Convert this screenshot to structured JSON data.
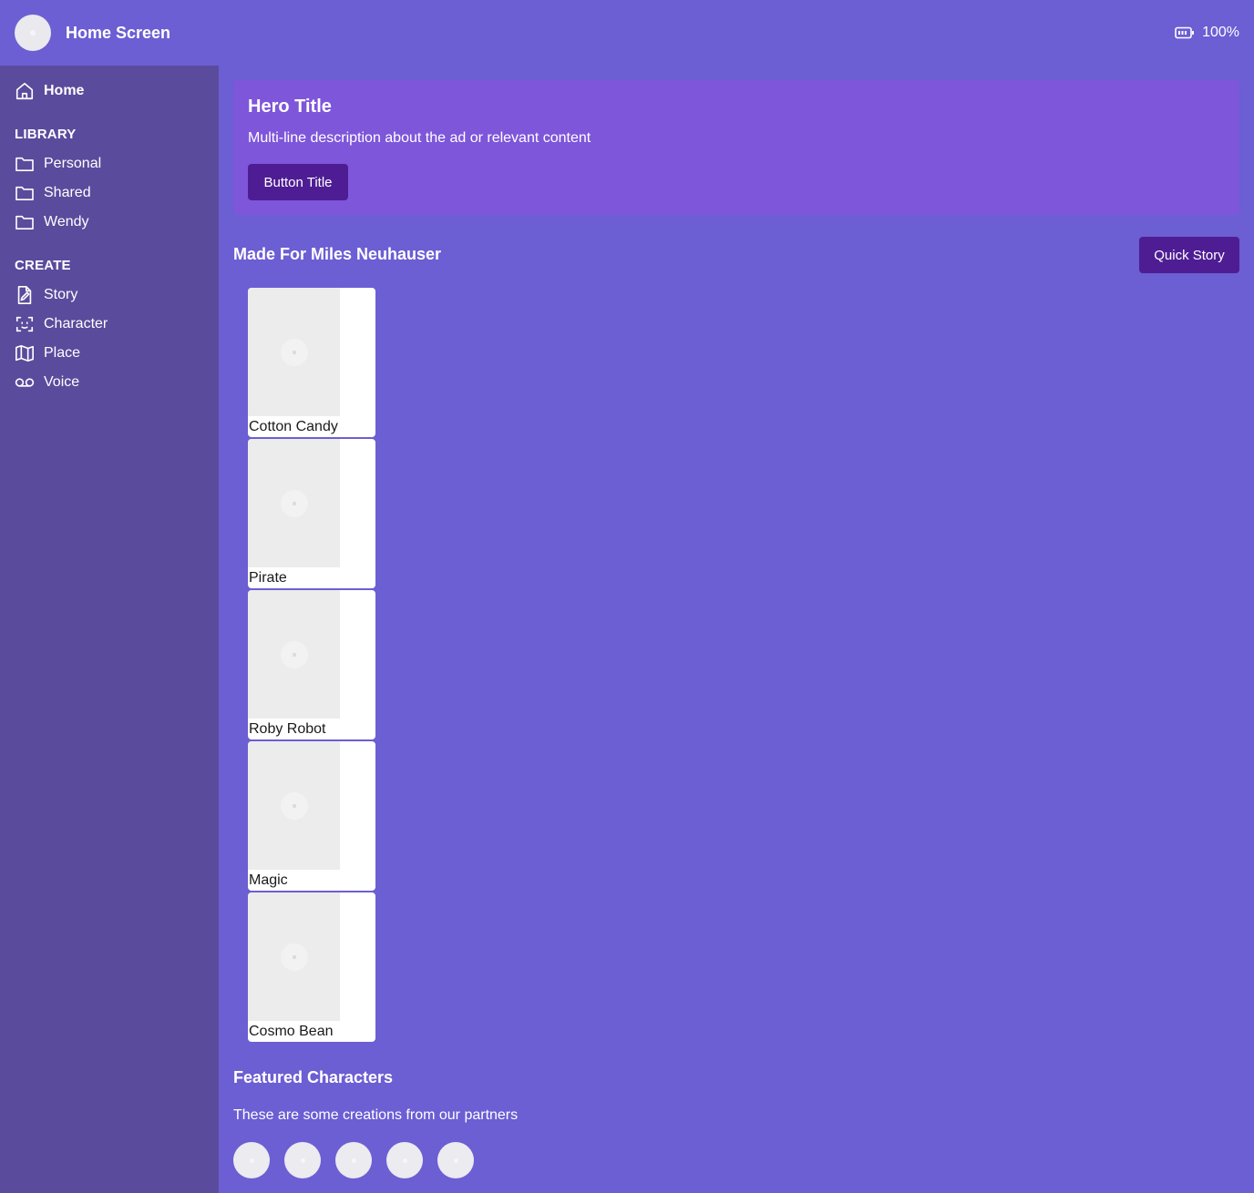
{
  "header": {
    "title": "Home Screen",
    "battery": "100%"
  },
  "sidebar": {
    "home": "Home",
    "library_label": "LIBRARY",
    "library": [
      "Personal",
      "Shared",
      "Wendy"
    ],
    "create_label": "CREATE",
    "create": [
      "Story",
      "Character",
      "Place",
      "Voice"
    ]
  },
  "hero": {
    "title": "Hero Title",
    "description": "Multi-line description about the ad or relevant content",
    "button": "Button Title"
  },
  "made_for": {
    "title": "Made For Miles Neuhauser",
    "quick_story": "Quick Story",
    "items": [
      "Cotton Candy",
      "Pirate",
      "Roby Robot",
      "Magic",
      "Cosmo Bean"
    ]
  },
  "featured": {
    "title": "Featured Characters",
    "description": "These are some creations from our partners"
  },
  "colors": {
    "background": "#6c5ed3",
    "sidebar": "#5b4b9c",
    "hero": "#7e56da",
    "button": "#4e1d94"
  }
}
